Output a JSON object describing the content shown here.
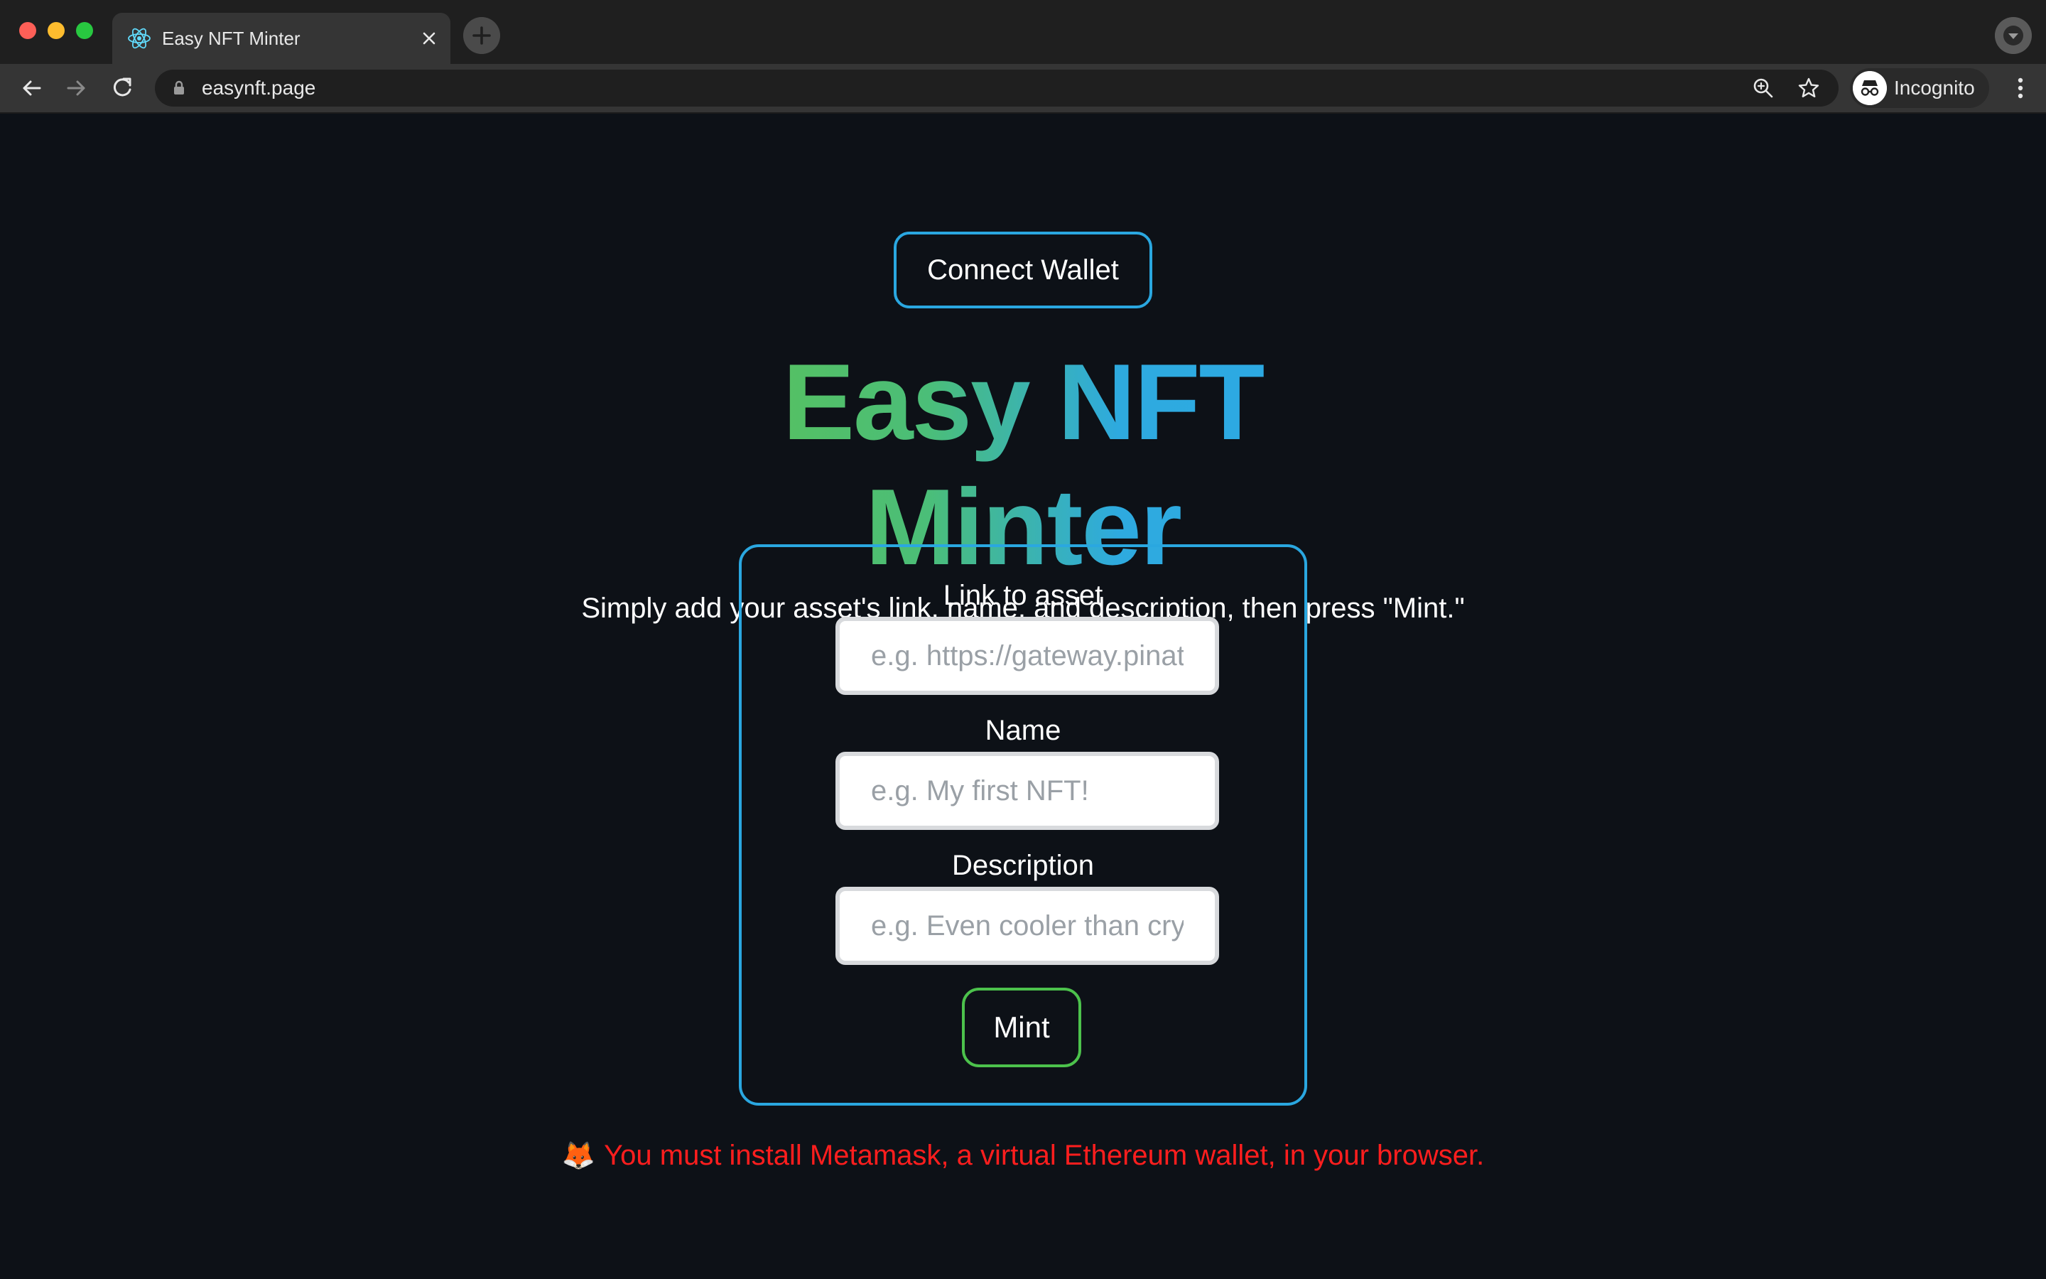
{
  "browser": {
    "tab_title": "Easy NFT Minter",
    "url": "easynft.page",
    "profile_label": "Incognito"
  },
  "page": {
    "connect_wallet_label": "Connect Wallet",
    "title": "Easy NFT Minter",
    "subtitle": "Simply add your asset's link, name, and description, then press \"Mint.\"",
    "form": {
      "fields": [
        {
          "label": "Link to asset",
          "value": "",
          "placeholder": "e.g. https://gateway.pinata.cloud/ipfs/<hash>"
        },
        {
          "label": "Name",
          "value": "",
          "placeholder": "e.g. My first NFT!"
        },
        {
          "label": "Description",
          "value": "",
          "placeholder": "e.g. Even cooler than cryptokitties ;)"
        }
      ],
      "mint_label": "Mint"
    },
    "status_icon": "🦊",
    "status_message": "You must install Metamask, a virtual Ethereum wallet, in your browser."
  },
  "colors": {
    "accent_blue": "#2aa7e0",
    "accent_green": "#4cc24c",
    "error_red": "#ff1e1e",
    "background": "#0d1117"
  }
}
